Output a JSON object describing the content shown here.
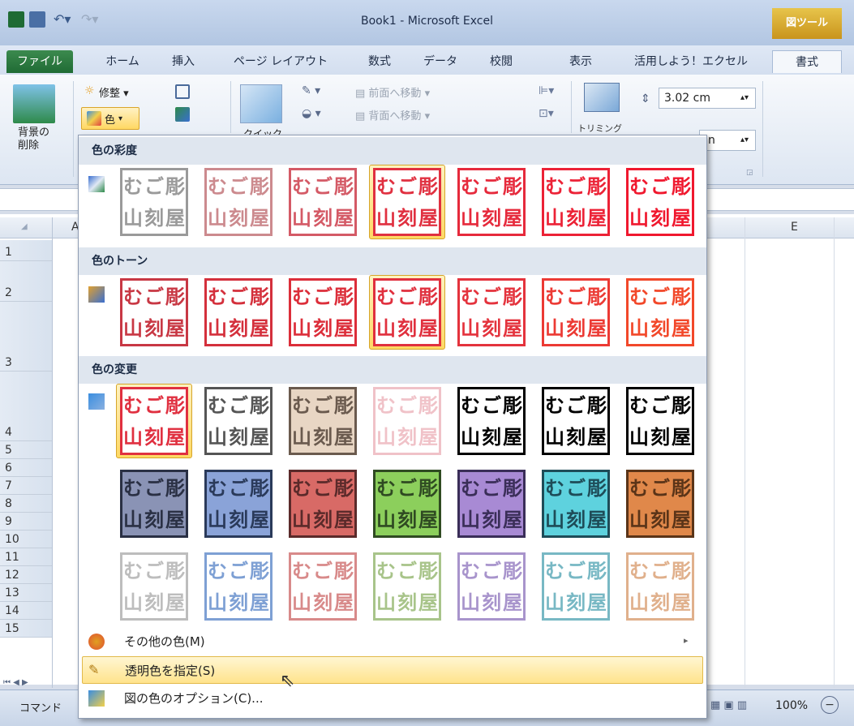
{
  "title": "Book1 - Microsoft Excel",
  "tool_label": "図ツール",
  "tabs": [
    "ファイル",
    "ホーム",
    "挿入",
    "ページ レイアウト",
    "数式",
    "データ",
    "校閲",
    "表示",
    "活用しよう！エクセル",
    "書式"
  ],
  "ribbon": {
    "remove_bg": "背景の\n削除",
    "corrections": "修整",
    "color": "色",
    "quick": "クイック",
    "bring_forward": "前面へ移動",
    "send_backward": "背面へ移動",
    "crop": "トリミング",
    "height": "3.02 cm",
    "width_partial": "n"
  },
  "grid": {
    "col_a": "A",
    "col_e": "E",
    "rows": [
      "1",
      "2",
      "3",
      "4",
      "5",
      "6",
      "7",
      "8",
      "9",
      "10",
      "11",
      "12",
      "13",
      "14",
      "15"
    ]
  },
  "statusbar": {
    "mode": "コマンド",
    "zoom": "100%"
  },
  "menu": {
    "sections": [
      {
        "heading": "色の彩度"
      },
      {
        "heading": "色のトーン"
      },
      {
        "heading": "色の変更"
      }
    ],
    "stamp_text": [
      "む",
      "ご",
      "彫",
      "山",
      "刻",
      "屋"
    ],
    "items": [
      {
        "label": "その他の色(M)",
        "hotkey": "M",
        "icon": "palette-icon",
        "has_submenu": true
      },
      {
        "label": "透明色を指定(S)",
        "hotkey": "S",
        "icon": "pen-icon",
        "highlighted": true
      },
      {
        "label": "図の色のオプション(C)...",
        "hotkey": "C",
        "icon": "color-options-icon"
      }
    ]
  },
  "colors": {
    "saturation": [
      "#9a9a9a",
      "#cc8a8e",
      "#d45a66",
      "#e03040",
      "#e62a3c",
      "#ec2236",
      "#f0182e"
    ],
    "tone": [
      "#c83844",
      "#d4303c",
      "#dc2e3a",
      "#e0303e",
      "#e4333d",
      "#ec3a34",
      "#f2482a"
    ],
    "recolor1": [
      "#e03040",
      "#555555",
      "#6a5a4e",
      "#f0c2c8",
      "#000000",
      "#000000",
      "#000000"
    ],
    "recolor2": [
      "#2a3044",
      "#2a3a5a",
      "#5a2a2a",
      "#2f4a22",
      "#3a2e58",
      "#1e4c58",
      "#5a3418"
    ],
    "recolor2_bg": [
      "#8a93b5",
      "#8aa3d8",
      "#d86a66",
      "#8ccf5c",
      "#a88ad4",
      "#5ed2de",
      "#e0884a"
    ],
    "recolor3": [
      "#bdbdbd",
      "#7ea0d4",
      "#d88a8a",
      "#a8c48a",
      "#a894cc",
      "#78b8c4",
      "#e0b08c"
    ]
  }
}
